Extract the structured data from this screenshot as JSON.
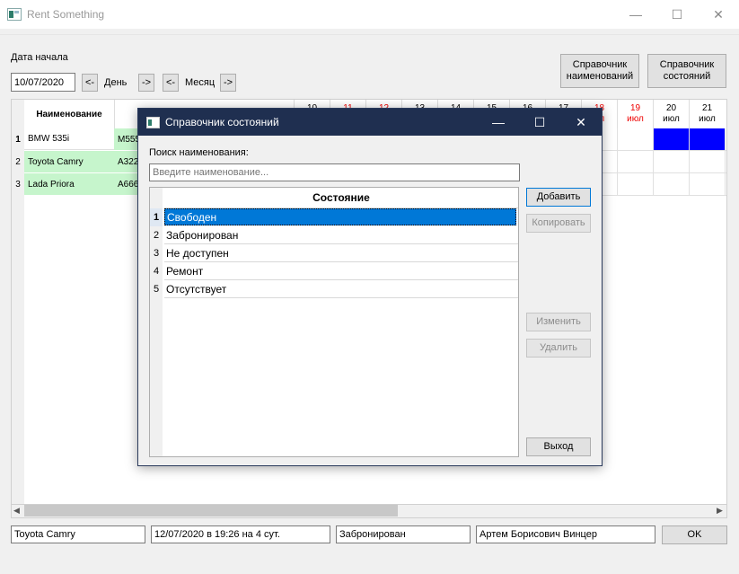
{
  "window": {
    "title": "Rent Something",
    "min": "—",
    "max": "☐",
    "close": "✕"
  },
  "toolbar": {
    "start_date_label": "Дата начала",
    "start_date_value": "10/07/2020",
    "day_prev": "<-",
    "day_label": "День",
    "day_next": "->",
    "month_prev": "<-",
    "month_label": "Месяц",
    "month_next": "->",
    "names_dict_button": "Справочник наименований",
    "states_dict_button": "Справочник состояний"
  },
  "grid": {
    "header_name": "Наименование",
    "rows": [
      {
        "num": "1",
        "name": "BMW 535i",
        "plate": "M555"
      },
      {
        "num": "2",
        "name": "Toyota Camry",
        "plate": "A322"
      },
      {
        "num": "3",
        "name": "Lada Priora",
        "plate": "A666"
      }
    ],
    "days": [
      {
        "day": "10",
        "month": "",
        "weekend": false
      },
      {
        "day": "11",
        "month": "",
        "weekend": true
      },
      {
        "day": "12",
        "month": "",
        "weekend": true
      },
      {
        "day": "13",
        "month": "",
        "weekend": false
      },
      {
        "day": "14",
        "month": "",
        "weekend": false
      },
      {
        "day": "15",
        "month": "",
        "weekend": false
      },
      {
        "day": "16",
        "month": "",
        "weekend": false
      },
      {
        "day": "17",
        "month": "",
        "weekend": false
      },
      {
        "day": "18",
        "month": "ил",
        "weekend": true
      },
      {
        "day": "19",
        "month": "июл",
        "weekend": true
      },
      {
        "day": "20",
        "month": "июл",
        "weekend": false
      },
      {
        "day": "21",
        "month": "июл",
        "weekend": false
      }
    ],
    "accent_booked": "#0000ff",
    "accent_weekend": "#ff0000"
  },
  "bottom": {
    "item": "Toyota Camry",
    "period": "12/07/2020 в 19:26 на 4 сут.",
    "state": "Забронирован",
    "person": "Артем Борисович Винцер",
    "ok_button": "OK"
  },
  "dialog": {
    "title": "Справочник состояний",
    "search_label": "Поиск наименования:",
    "search_placeholder": "Введите наименование...",
    "column_header": "Состояние",
    "rows": [
      {
        "num": "1",
        "label": "Свободен",
        "selected": true
      },
      {
        "num": "2",
        "label": "Забронирован",
        "selected": false
      },
      {
        "num": "3",
        "label": "Не доступен",
        "selected": false
      },
      {
        "num": "4",
        "label": "Ремонт",
        "selected": false
      },
      {
        "num": "5",
        "label": "Отсутствует",
        "selected": false
      }
    ],
    "buttons": {
      "add": "Добавить",
      "copy": "Копировать",
      "edit": "Изменить",
      "delete": "Удалить",
      "exit": "Выход"
    }
  }
}
